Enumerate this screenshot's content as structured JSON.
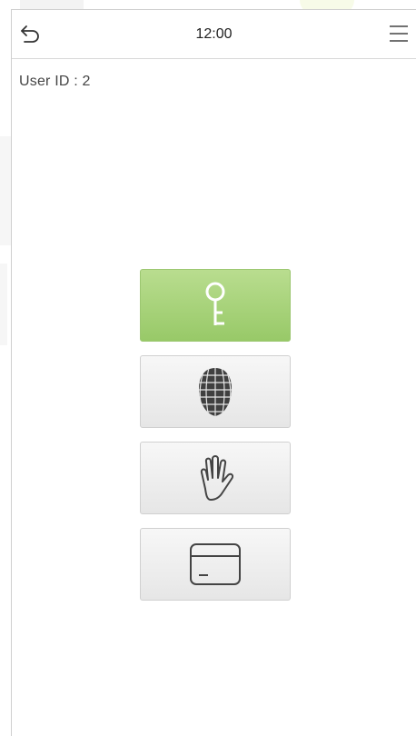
{
  "status_bar": {
    "time": "12:00"
  },
  "icons": {
    "back": "undo-arrow-icon",
    "menu": "hamburger-menu-icon",
    "password": "key-icon",
    "face": "face-scan-icon",
    "palm": "palm-icon",
    "card": "card-icon"
  },
  "user": {
    "id_label": "User ID : 2"
  },
  "verification_methods": [
    {
      "name": "password",
      "icon": "key-icon",
      "selected": true
    },
    {
      "name": "face",
      "icon": "face-scan-icon",
      "selected": false
    },
    {
      "name": "palm",
      "icon": "palm-icon",
      "selected": false
    },
    {
      "name": "card",
      "icon": "card-icon",
      "selected": false
    }
  ],
  "colors": {
    "selected_button": "#a9d47c",
    "unselected_button": "#eeeeee",
    "icon_light": "#ffffff",
    "icon_dark": "#4a4a4a"
  }
}
